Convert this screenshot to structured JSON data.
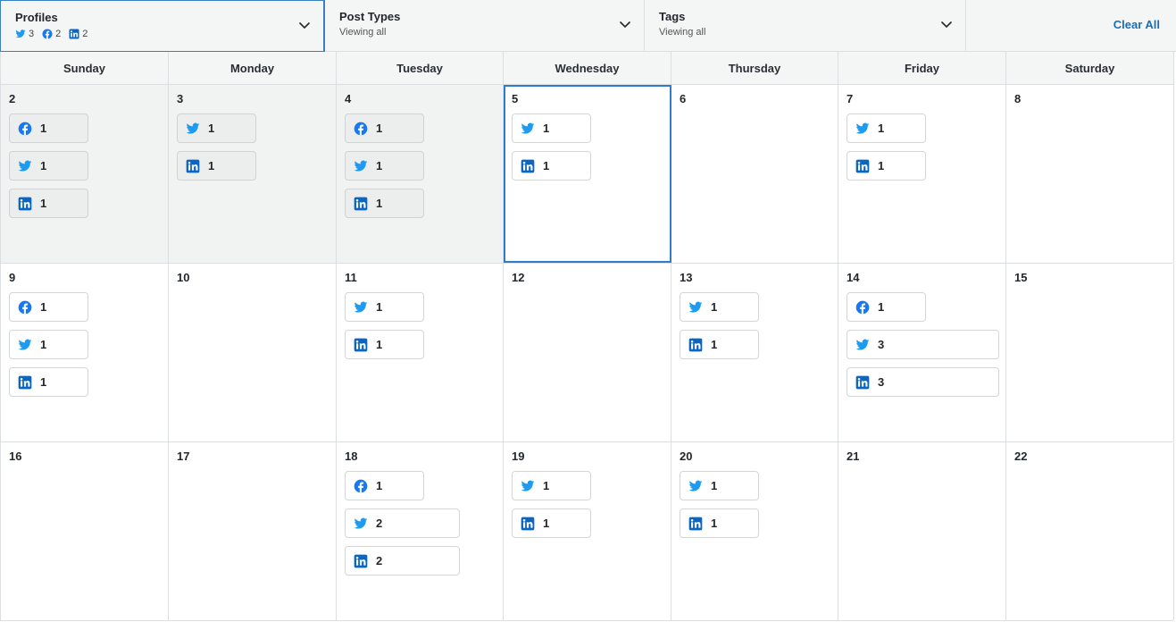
{
  "filters": {
    "profiles": {
      "title": "Profiles",
      "twitter_count": "3",
      "facebook_count": "2",
      "linkedin_count": "2"
    },
    "post_types": {
      "title": "Post Types",
      "sub": "Viewing all"
    },
    "tags": {
      "title": "Tags",
      "sub": "Viewing all"
    },
    "clear_all": "Clear All"
  },
  "colors": {
    "twitter": "#1d9bf0",
    "facebook": "#1877f2",
    "linkedin": "#0a66c2",
    "accent": "#2f7ccc"
  },
  "weekdays": [
    "Sunday",
    "Monday",
    "Tuesday",
    "Wednesday",
    "Thursday",
    "Friday",
    "Saturday"
  ],
  "weeks": [
    [
      {
        "date": "2",
        "state": "past",
        "posts": [
          {
            "network": "facebook",
            "count": "1"
          },
          {
            "network": "twitter",
            "count": "1"
          },
          {
            "network": "linkedin",
            "count": "1"
          }
        ]
      },
      {
        "date": "3",
        "state": "past",
        "posts": [
          {
            "network": "twitter",
            "count": "1"
          },
          {
            "network": "linkedin",
            "count": "1"
          }
        ]
      },
      {
        "date": "4",
        "state": "past",
        "posts": [
          {
            "network": "facebook",
            "count": "1"
          },
          {
            "network": "twitter",
            "count": "1"
          },
          {
            "network": "linkedin",
            "count": "1"
          }
        ]
      },
      {
        "date": "5",
        "state": "today",
        "posts": [
          {
            "network": "twitter",
            "count": "1"
          },
          {
            "network": "linkedin",
            "count": "1"
          }
        ]
      },
      {
        "date": "6",
        "state": "",
        "posts": []
      },
      {
        "date": "7",
        "state": "",
        "posts": [
          {
            "network": "twitter",
            "count": "1"
          },
          {
            "network": "linkedin",
            "count": "1"
          }
        ]
      },
      {
        "date": "8",
        "state": "",
        "posts": []
      }
    ],
    [
      {
        "date": "9",
        "state": "",
        "posts": [
          {
            "network": "facebook",
            "count": "1"
          },
          {
            "network": "twitter",
            "count": "1"
          },
          {
            "network": "linkedin",
            "count": "1"
          }
        ]
      },
      {
        "date": "10",
        "state": "",
        "posts": []
      },
      {
        "date": "11",
        "state": "",
        "posts": [
          {
            "network": "twitter",
            "count": "1"
          },
          {
            "network": "linkedin",
            "count": "1"
          }
        ]
      },
      {
        "date": "12",
        "state": "",
        "posts": []
      },
      {
        "date": "13",
        "state": "",
        "posts": [
          {
            "network": "twitter",
            "count": "1"
          },
          {
            "network": "linkedin",
            "count": "1"
          }
        ]
      },
      {
        "date": "14",
        "state": "",
        "posts": [
          {
            "network": "facebook",
            "count": "1"
          },
          {
            "network": "twitter",
            "count": "3",
            "size": "xwide"
          },
          {
            "network": "linkedin",
            "count": "3",
            "size": "xwide"
          }
        ]
      },
      {
        "date": "15",
        "state": "",
        "posts": []
      }
    ],
    [
      {
        "date": "16",
        "state": "",
        "posts": []
      },
      {
        "date": "17",
        "state": "",
        "posts": []
      },
      {
        "date": "18",
        "state": "",
        "posts": [
          {
            "network": "facebook",
            "count": "1"
          },
          {
            "network": "twitter",
            "count": "2",
            "size": "wide"
          },
          {
            "network": "linkedin",
            "count": "2",
            "size": "wide"
          }
        ]
      },
      {
        "date": "19",
        "state": "",
        "posts": [
          {
            "network": "twitter",
            "count": "1"
          },
          {
            "network": "linkedin",
            "count": "1"
          }
        ]
      },
      {
        "date": "20",
        "state": "",
        "posts": [
          {
            "network": "twitter",
            "count": "1"
          },
          {
            "network": "linkedin",
            "count": "1"
          }
        ]
      },
      {
        "date": "21",
        "state": "",
        "posts": []
      },
      {
        "date": "22",
        "state": "",
        "posts": []
      }
    ]
  ]
}
